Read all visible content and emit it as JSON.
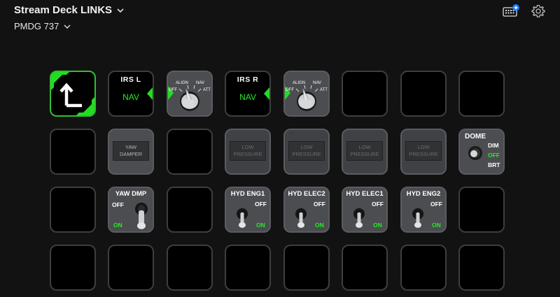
{
  "header": {
    "device_title": "Stream Deck LINKS",
    "profile_title": "PMDG 737"
  },
  "colors": {
    "background": "#121212",
    "active_green": "#22ee22",
    "key_border": "#3e3e3e",
    "panel_gray": "#4b4d50",
    "notification_blue": "#1e7bf0"
  },
  "icons": {
    "device_chevron": "chevron-down-icon",
    "profile_chevron": "chevron-down-icon",
    "keyboard": "keyboard-icon",
    "settings": "gear-icon",
    "back": "arrow-up-left-icon"
  },
  "keys": {
    "irs_l": {
      "label": "IRS  L",
      "mode": "NAV"
    },
    "irs_r": {
      "label": "IRS  R",
      "mode": "NAV"
    },
    "knob_left": {
      "align": "ALIGN",
      "nav": "NAV",
      "off": "OFF",
      "att": "ATT"
    },
    "knob_right": {
      "align": "ALIGN",
      "nav": "NAV",
      "off": "OFF",
      "att": "ATT"
    },
    "yaw_annunciator": "YAW\nDAMPER",
    "low_pressure_1": "LOW\nPRESSURE",
    "low_pressure_2": "LOW\nPRESSURE",
    "low_pressure_3": "LOW\nPRESSURE",
    "low_pressure_4": "LOW\nPRESSURE",
    "dome": {
      "label": "DOME",
      "dim": "DIM",
      "off": "OFF",
      "brt": "BRT"
    },
    "yaw_dmp": {
      "label": "YAW DMP",
      "off": "OFF",
      "on": "ON"
    },
    "hyd_eng1": {
      "label": "HYD ENG1",
      "off": "OFF",
      "on": "ON"
    },
    "hyd_elec2": {
      "label": "HYD ELEC2",
      "off": "OFF",
      "on": "ON"
    },
    "hyd_elec1": {
      "label": "HYD ELEC1",
      "off": "OFF",
      "on": "ON"
    },
    "hyd_eng2": {
      "label": "HYD ENG2",
      "off": "OFF",
      "on": "ON"
    }
  }
}
